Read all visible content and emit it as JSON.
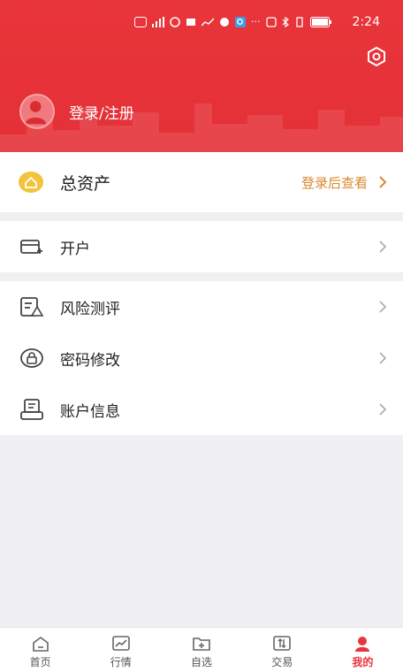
{
  "status_bar": {
    "time": "2:24"
  },
  "header": {
    "login_label": "登录/注册"
  },
  "assets": {
    "label": "总资产",
    "link_label": "登录后查看"
  },
  "menu_section_1": [
    {
      "label": "开户"
    }
  ],
  "menu_section_2": [
    {
      "label": "风险测评"
    },
    {
      "label": "密码修改"
    },
    {
      "label": "账户信息"
    }
  ],
  "tabs": [
    {
      "label": "首页",
      "icon": "home-icon",
      "active": false
    },
    {
      "label": "行情",
      "icon": "chart-icon",
      "active": false
    },
    {
      "label": "自选",
      "icon": "folder-plus-icon",
      "active": false
    },
    {
      "label": "交易",
      "icon": "exchange-icon",
      "active": false
    },
    {
      "label": "我的",
      "icon": "user-icon",
      "active": true
    }
  ],
  "colors": {
    "brand_red": "#e8353a",
    "accent_orange": "#d9892f",
    "background": "#f0f0f2"
  }
}
